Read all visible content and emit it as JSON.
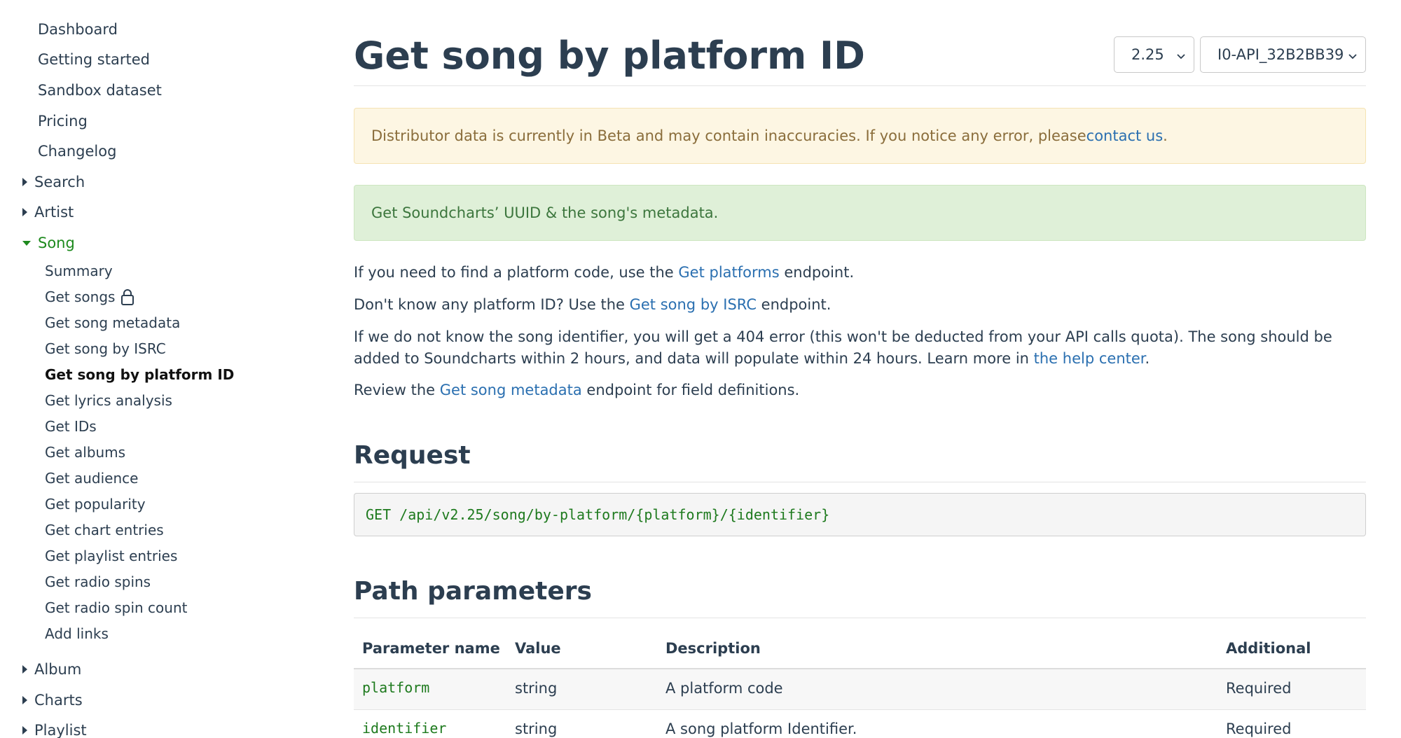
{
  "sidebar": {
    "top_items": [
      "Dashboard",
      "Getting started",
      "Sandbox dataset",
      "Pricing",
      "Changelog"
    ],
    "sections": {
      "search": "Search",
      "artist": "Artist",
      "song": "Song",
      "album": "Album",
      "charts": "Charts",
      "playlist": "Playlist"
    },
    "song_items": [
      "Summary",
      "Get songs",
      "Get song metadata",
      "Get song by ISRC",
      "Get song by platform ID",
      "Get lyrics analysis",
      "Get IDs",
      "Get albums",
      "Get audience",
      "Get popularity",
      "Get chart entries",
      "Get playlist entries",
      "Get radio spins",
      "Get radio spin count",
      "Add links"
    ]
  },
  "header": {
    "title": "Get song by platform ID",
    "version_select": "2.25",
    "app_select": "I0-API_32B2BB39"
  },
  "alerts": {
    "beta_text": "Distributor data is currently in Beta and may contain inaccuracies. If you notice any error, please ",
    "beta_link": "contact us",
    "beta_end": ".",
    "info_text": "Get Soundcharts’ UUID & the song's metadata."
  },
  "body": {
    "p1_a": "If you need to find a platform code, use the ",
    "p1_link": "Get platforms",
    "p1_b": " endpoint.",
    "p2_a": "Don't know any platform ID? Use the ",
    "p2_link": "Get song by ISRC",
    "p2_b": " endpoint.",
    "p3_a": "If we do not know the song identifier, you will get a 404 error (this won't be deducted from your API calls quota). The song should be added to Soundcharts within 2 hours, and data will populate within 24 hours. Learn more in ",
    "p3_link": "the help center",
    "p3_b": ".",
    "p4_a": "Review the ",
    "p4_link": "Get song metadata",
    "p4_b": " endpoint for field definitions."
  },
  "request": {
    "heading": "Request",
    "endpoint": "GET /api/v2.25/song/by-platform/{platform}/{identifier}"
  },
  "path_params": {
    "heading": "Path parameters",
    "columns": [
      "Parameter name",
      "Value",
      "Description",
      "Additional"
    ],
    "rows": [
      {
        "name": "platform",
        "value": "string",
        "description": "A platform code",
        "additional": "Required"
      },
      {
        "name": "identifier",
        "value": "string",
        "description": "A song platform Identifier.",
        "additional": "Required"
      }
    ]
  }
}
